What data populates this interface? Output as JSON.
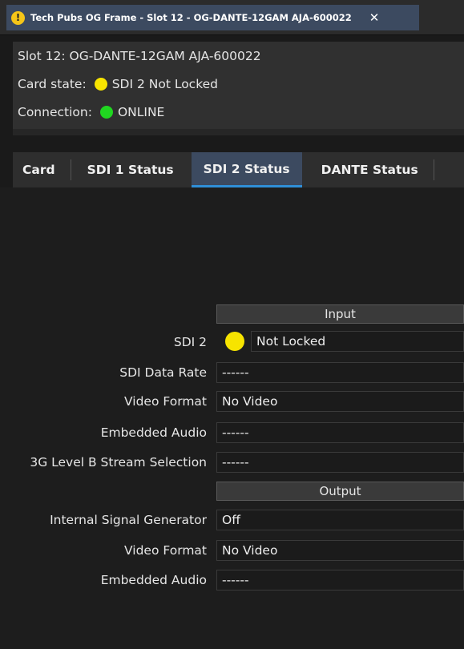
{
  "window": {
    "tab_title": "Tech Pubs OG Frame - Slot 12 - OG-DANTE-12GAM AJA-600022",
    "close_glyph": "✕",
    "warning_glyph": "!"
  },
  "info": {
    "slot": "Slot 12: OG-DANTE-12GAM AJA-600022",
    "card_state_label": "Card state:",
    "card_state_value": "SDI 2 Not Locked",
    "card_state_color": "#f7e400",
    "connection_label": "Connection:",
    "connection_value": "ONLINE",
    "connection_color": "#20d620"
  },
  "tabs": [
    {
      "label": "Card",
      "active": false
    },
    {
      "label": "SDI 1 Status",
      "active": false
    },
    {
      "label": "SDI 2 Status",
      "active": true
    },
    {
      "label": "DANTE Status",
      "active": false
    }
  ],
  "input_section": {
    "header": "Input",
    "rows": [
      {
        "label": "SDI 2",
        "value": "Not Locked",
        "indicator_color": "#f7e400"
      },
      {
        "label": "SDI Data Rate",
        "value": "------"
      },
      {
        "label": "Video Format",
        "value": "No Video"
      },
      {
        "label": "Embedded Audio",
        "value": "------"
      },
      {
        "label": "3G Level B Stream Selection",
        "value": "------"
      }
    ]
  },
  "output_section": {
    "header": "Output",
    "rows": [
      {
        "label": "Internal Signal Generator",
        "value": "Off"
      },
      {
        "label": "Video Format",
        "value": "No Video"
      },
      {
        "label": "Embedded Audio",
        "value": "------"
      }
    ]
  },
  "colors": {
    "accent": "#2f8fd8",
    "active_tab_bg": "#3c4a60",
    "warning": "#f5c518"
  }
}
